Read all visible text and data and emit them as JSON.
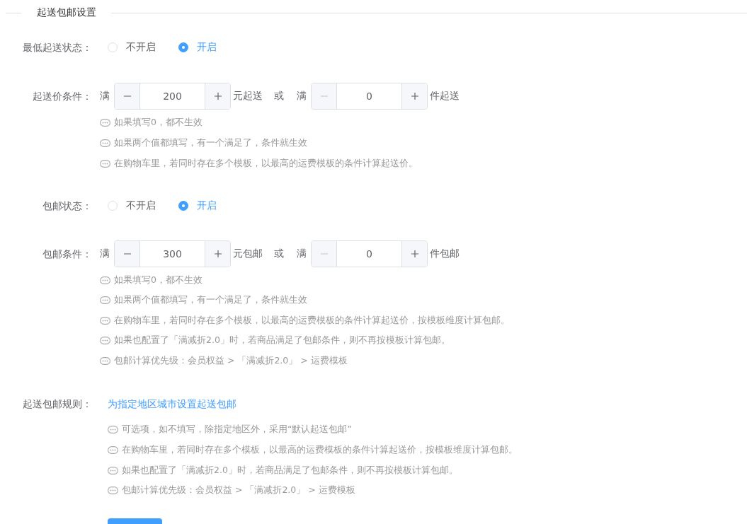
{
  "section_title": "起送包邮设置",
  "rows": [
    {
      "kind": "radio",
      "label": "最低起送状态：",
      "options": [
        {
          "label": "不开启",
          "selected": false
        },
        {
          "label": "开启",
          "selected": true
        }
      ]
    },
    {
      "kind": "condition",
      "label": "起送价条件：",
      "joiner": "或",
      "steppers": [
        {
          "prefix": "满",
          "value": "200",
          "minus_disabled": false,
          "suffix": "元起送"
        },
        {
          "prefix": "满",
          "value": "0",
          "minus_disabled": true,
          "suffix": "件起送"
        }
      ],
      "hints": [
        "如果填写0，都不生效",
        "如果两个值都填写，有一个满足了，条件就生效",
        "在购物车里，若同时存在多个模板，以最高的运费模板的条件计算起送价。"
      ]
    },
    {
      "kind": "radio",
      "label": "包邮状态：",
      "options": [
        {
          "label": "不开启",
          "selected": false
        },
        {
          "label": "开启",
          "selected": true
        }
      ]
    },
    {
      "kind": "condition",
      "label": "包邮条件：",
      "joiner": "或",
      "steppers": [
        {
          "prefix": "满",
          "value": "300",
          "minus_disabled": false,
          "suffix": "元包邮"
        },
        {
          "prefix": "满",
          "value": "0",
          "minus_disabled": true,
          "suffix": "件包邮"
        }
      ],
      "hints": [
        "如果填写0，都不生效",
        "如果两个值都填写，有一个满足了，条件就生效",
        "在购物车里，若同时存在多个模板，以最高的运费模板的条件计算起送价，按模板维度计算包邮。",
        "如果也配置了「满减折2.0」时，若商品满足了包邮条件，则不再按模板计算包邮。",
        "包邮计算优先级：会员权益 > 「满减折2.0」 > 运费模板"
      ]
    },
    {
      "kind": "link",
      "label": "起送包邮规则：",
      "link": "为指定地区城市设置起送包邮",
      "hints": [
        "可选项，如不填写，除指定地区外，采用“默认起送包邮”",
        "在购物车里，若同时存在多个模板，以最高的运费模板的条件计算起送价，按模板维度计算包邮。",
        "如果也配置了「满减折2.0」时，若商品满足了包邮条件，则不再按模板计算包邮。",
        "包邮计算优先级：会员权益 > 「满减折2.0」 > 运费模板"
      ]
    }
  ]
}
